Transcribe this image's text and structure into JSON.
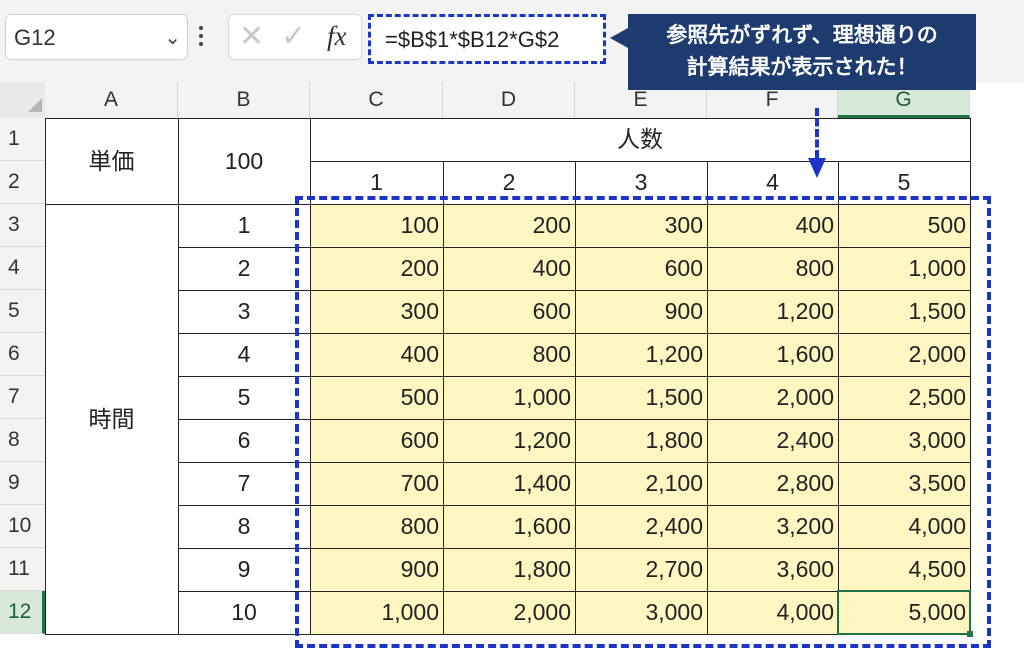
{
  "namebox": {
    "value": "G12"
  },
  "formula_bar": {
    "cancel_icon": "close-icon",
    "enter_icon": "check-icon",
    "fx_label": "fx",
    "formula": "=$B$1*$B12*G$2"
  },
  "callout": {
    "line1": "参照先がずれず、理想通りの",
    "line2": "計算結果が表示された！"
  },
  "columns": [
    "A",
    "B",
    "C",
    "D",
    "E",
    "F",
    "G"
  ],
  "rows": [
    "1",
    "2",
    "3",
    "4",
    "5",
    "6",
    "7",
    "8",
    "9",
    "10",
    "11",
    "12"
  ],
  "table": {
    "unit_price_label": "単価",
    "unit_price_value": "100",
    "people_label": "人数",
    "time_label": "時間",
    "people": [
      "1",
      "2",
      "3",
      "4",
      "5"
    ],
    "hours": [
      "1",
      "2",
      "3",
      "4",
      "5",
      "6",
      "7",
      "8",
      "9",
      "10"
    ],
    "values": [
      [
        "100",
        "200",
        "300",
        "400",
        "500"
      ],
      [
        "200",
        "400",
        "600",
        "800",
        "1,000"
      ],
      [
        "300",
        "600",
        "900",
        "1,200",
        "1,500"
      ],
      [
        "400",
        "800",
        "1,200",
        "1,600",
        "2,000"
      ],
      [
        "500",
        "1,000",
        "1,500",
        "2,000",
        "2,500"
      ],
      [
        "600",
        "1,200",
        "1,800",
        "2,400",
        "3,000"
      ],
      [
        "700",
        "1,400",
        "2,100",
        "2,800",
        "3,500"
      ],
      [
        "800",
        "1,600",
        "2,400",
        "3,200",
        "4,000"
      ],
      [
        "900",
        "1,800",
        "2,700",
        "3,600",
        "4,500"
      ],
      [
        "1,000",
        "2,000",
        "3,000",
        "4,000",
        "5,000"
      ]
    ]
  },
  "selected_cell": "G12",
  "colors": {
    "highlight_fill": "#fff6c2",
    "annotation_blue": "#1d35c6",
    "callout_bg": "#1e3b6f",
    "excel_green": "#217346"
  }
}
